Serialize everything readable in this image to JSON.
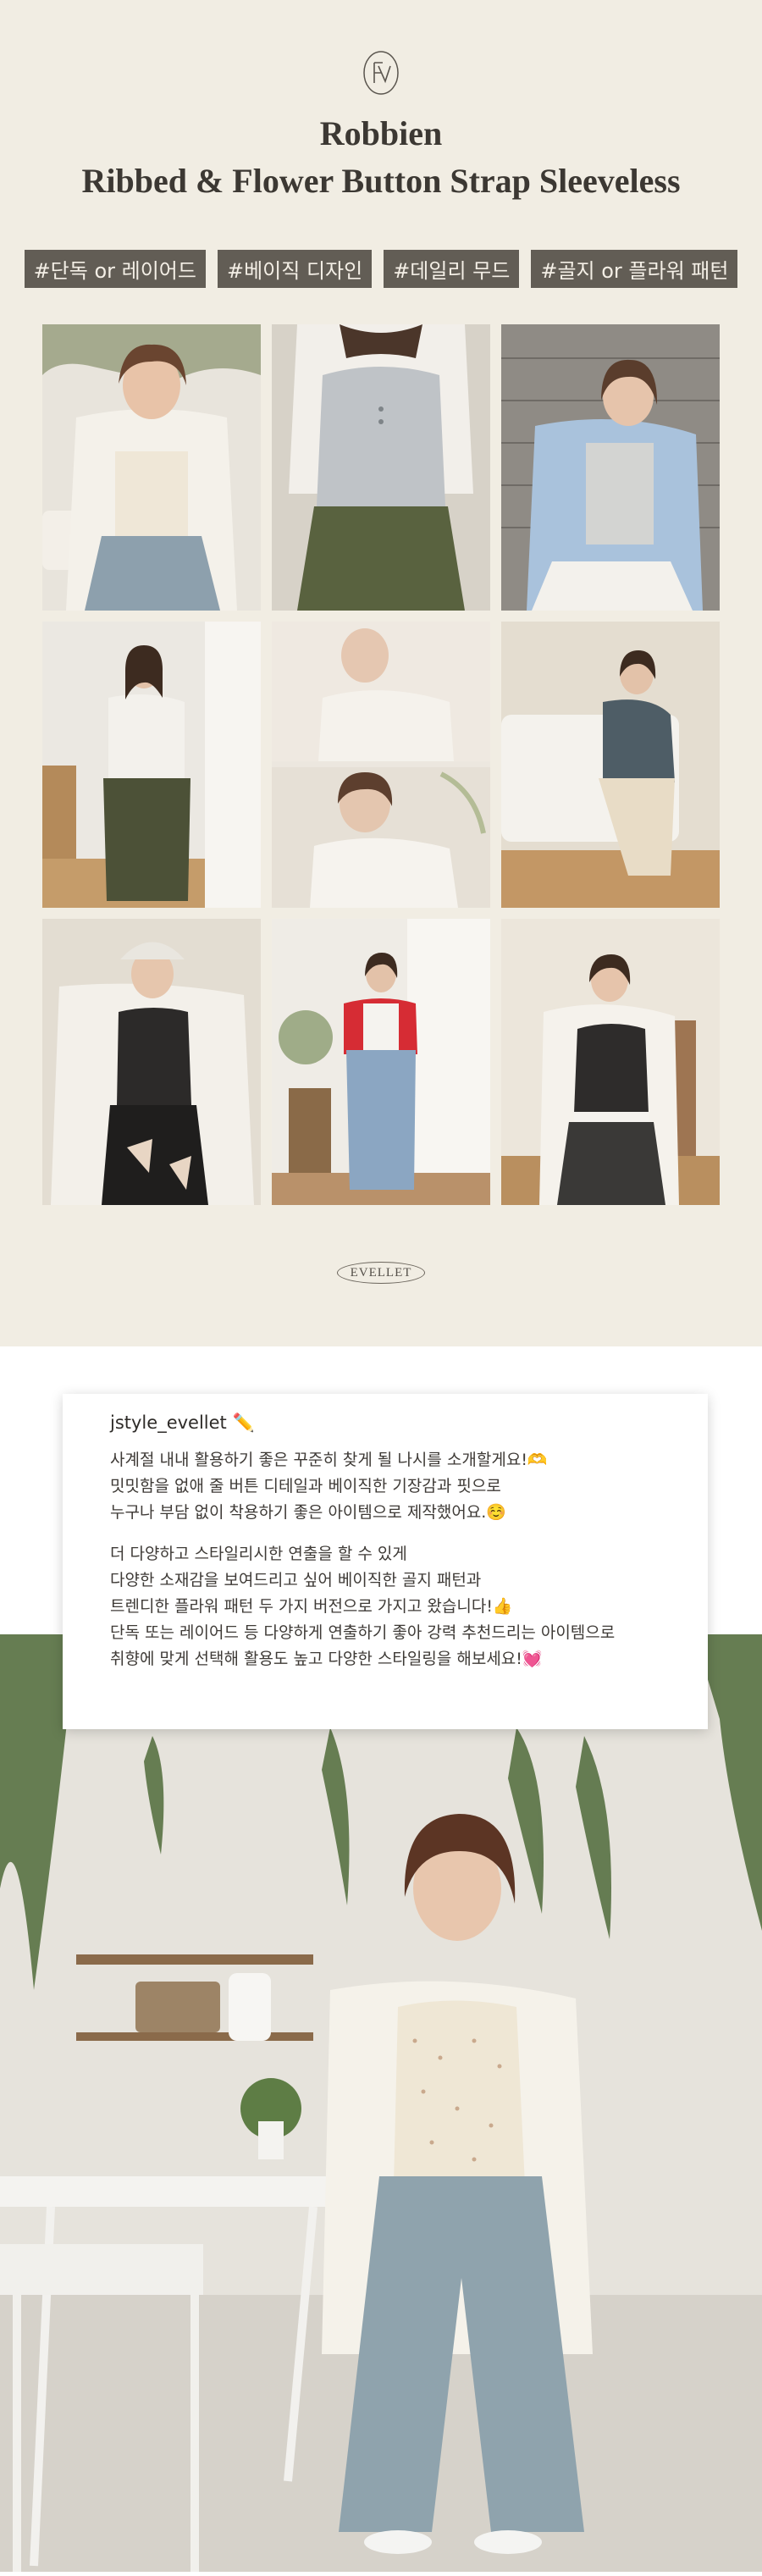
{
  "header": {
    "brand_title": "Robbien",
    "product_title": "Ribbed & Flower Button Strap Sleeveless"
  },
  "tags": [
    "#단독 or 레이어드",
    "#베이직 디자인",
    "#데일리 무드",
    "#골지 or 플라워 패턴"
  ],
  "seal_text": "EVELLET",
  "description": {
    "author": "jstyle_evellet ✏️",
    "paragraph1": [
      "사계절 내내 활용하기 좋은 꾸준히 찾게 될 나시를 소개할게요!🫶",
      "밋밋함을 없애 줄 버튼 디테일과 베이직한 기장감과 핏으로",
      "누구나 부담 없이 착용하기 좋은 아이템으로 제작했어요.☺️"
    ],
    "paragraph2": [
      "더 다양하고 스타일리시한 연출을 할 수 있게",
      "다양한 소재감을 보여드리고 싶어 베이직한 골지 패턴과",
      "트렌디한 플라워 패턴 두 가지 버전으로 가지고 왔습니다!👍",
      "단독 또는 레이어드 등 다양하게 연출하기 좋아 강력 추천드리는 아이템으로",
      "취향에 맞게 선택해 활용도 높고 다양한 스타일링을 해보세요!💓"
    ]
  },
  "colors": {
    "hero_bg": "#f1ede3",
    "tag_bg": "#625d55",
    "tag_text": "#f4efe6",
    "title_text": "#3c3833"
  }
}
